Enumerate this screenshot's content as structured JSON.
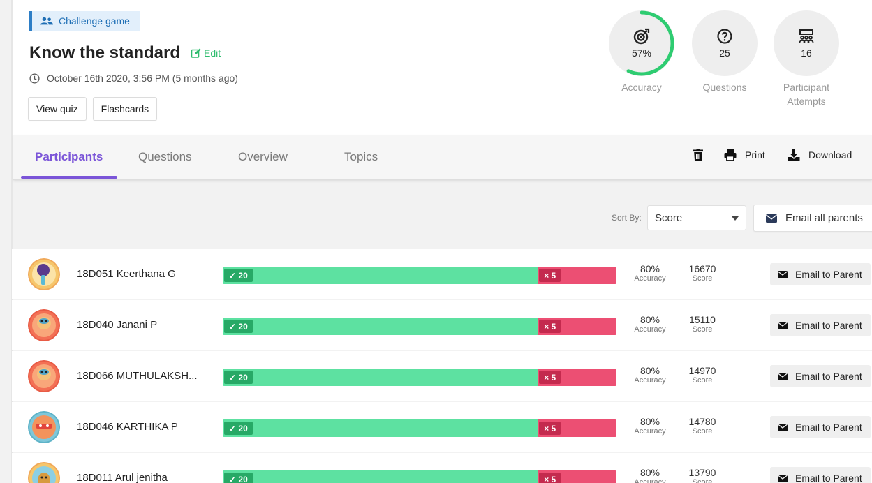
{
  "header": {
    "mode": "Challenge game",
    "title": "Know the standard",
    "edit_label": "Edit",
    "date": "October 16th 2020, 3:56 PM (5 months ago)",
    "buttons": {
      "view_quiz": "View quiz",
      "flashcards": "Flashcards"
    }
  },
  "stats": {
    "accuracy": {
      "value": "57%",
      "label": "Accuracy",
      "fraction": 0.57
    },
    "questions": {
      "value": "25",
      "label": "Questions"
    },
    "attempts": {
      "value": "16",
      "label": "Participant Attempts"
    }
  },
  "tabs": {
    "participants": "Participants",
    "questions": "Questions",
    "overview": "Overview",
    "topics": "Topics"
  },
  "tools": {
    "print": "Print",
    "download": "Download"
  },
  "sort": {
    "label": "Sort By:",
    "value": "Score"
  },
  "email_all": "Email all parents",
  "row_labels": {
    "accuracy": "Accuracy",
    "score": "Score",
    "email": "Email to Parent"
  },
  "participants": [
    {
      "name": "18D051 Keerthana G",
      "correct": "20",
      "incorrect": "5",
      "accuracy": "80%",
      "score": "16670",
      "correct_fraction": 0.8
    },
    {
      "name": "18D040 Janani P",
      "correct": "20",
      "incorrect": "5",
      "accuracy": "80%",
      "score": "15110",
      "correct_fraction": 0.8
    },
    {
      "name": "18D066 MUTHULAKSH...",
      "correct": "20",
      "incorrect": "5",
      "accuracy": "80%",
      "score": "14970",
      "correct_fraction": 0.8
    },
    {
      "name": "18D046 KARTHIKA P",
      "correct": "20",
      "incorrect": "5",
      "accuracy": "80%",
      "score": "14780",
      "correct_fraction": 0.8
    },
    {
      "name": "18D011 Arul jenitha",
      "correct": "20",
      "incorrect": "5",
      "accuracy": "80%",
      "score": "13790",
      "correct_fraction": 0.8
    }
  ],
  "colors": {
    "accent": "#7b55d8",
    "correct": "#5de1a1",
    "incorrect": "#ec4f73",
    "accuracy_ring": "#2ecc71",
    "badge": "#1f6fb5"
  }
}
